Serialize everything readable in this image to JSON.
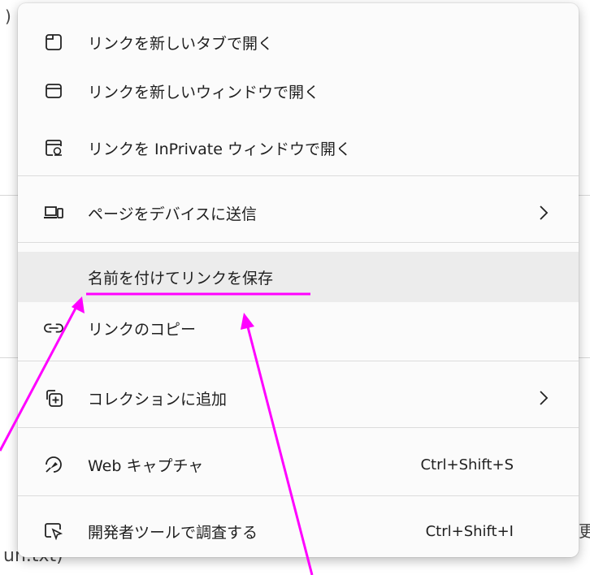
{
  "background": {
    "fragment_paren": ")",
    "fragment_bottom": "un.txt)",
    "fragment_right": "更"
  },
  "menu": {
    "items": [
      {
        "label": "リンクを新しいタブで開く",
        "icon": "new-tab-icon"
      },
      {
        "label": "リンクを新しいウィンドウで開く",
        "icon": "new-window-icon"
      },
      {
        "label": "リンクを InPrivate ウィンドウで開く",
        "icon": "inprivate-window-icon"
      },
      {
        "label": "ページをデバイスに送信",
        "icon": "send-to-devices-icon",
        "submenu": true
      },
      {
        "label": "名前を付けてリンクを保存",
        "icon": "",
        "highlighted": true
      },
      {
        "label": "リンクのコピー",
        "icon": "link-icon"
      },
      {
        "label": "コレクションに追加",
        "icon": "add-to-collections-icon",
        "submenu": true
      },
      {
        "label": "Web キャプチャ",
        "icon": "web-capture-icon",
        "shortcut": "Ctrl+Shift+S"
      },
      {
        "label": "開発者ツールで調査する",
        "icon": "inspect-icon",
        "shortcut": "Ctrl+Shift+I"
      }
    ]
  },
  "annotation": {
    "underline_color": "#ff00ff",
    "arrow_color": "#ff00ff"
  }
}
